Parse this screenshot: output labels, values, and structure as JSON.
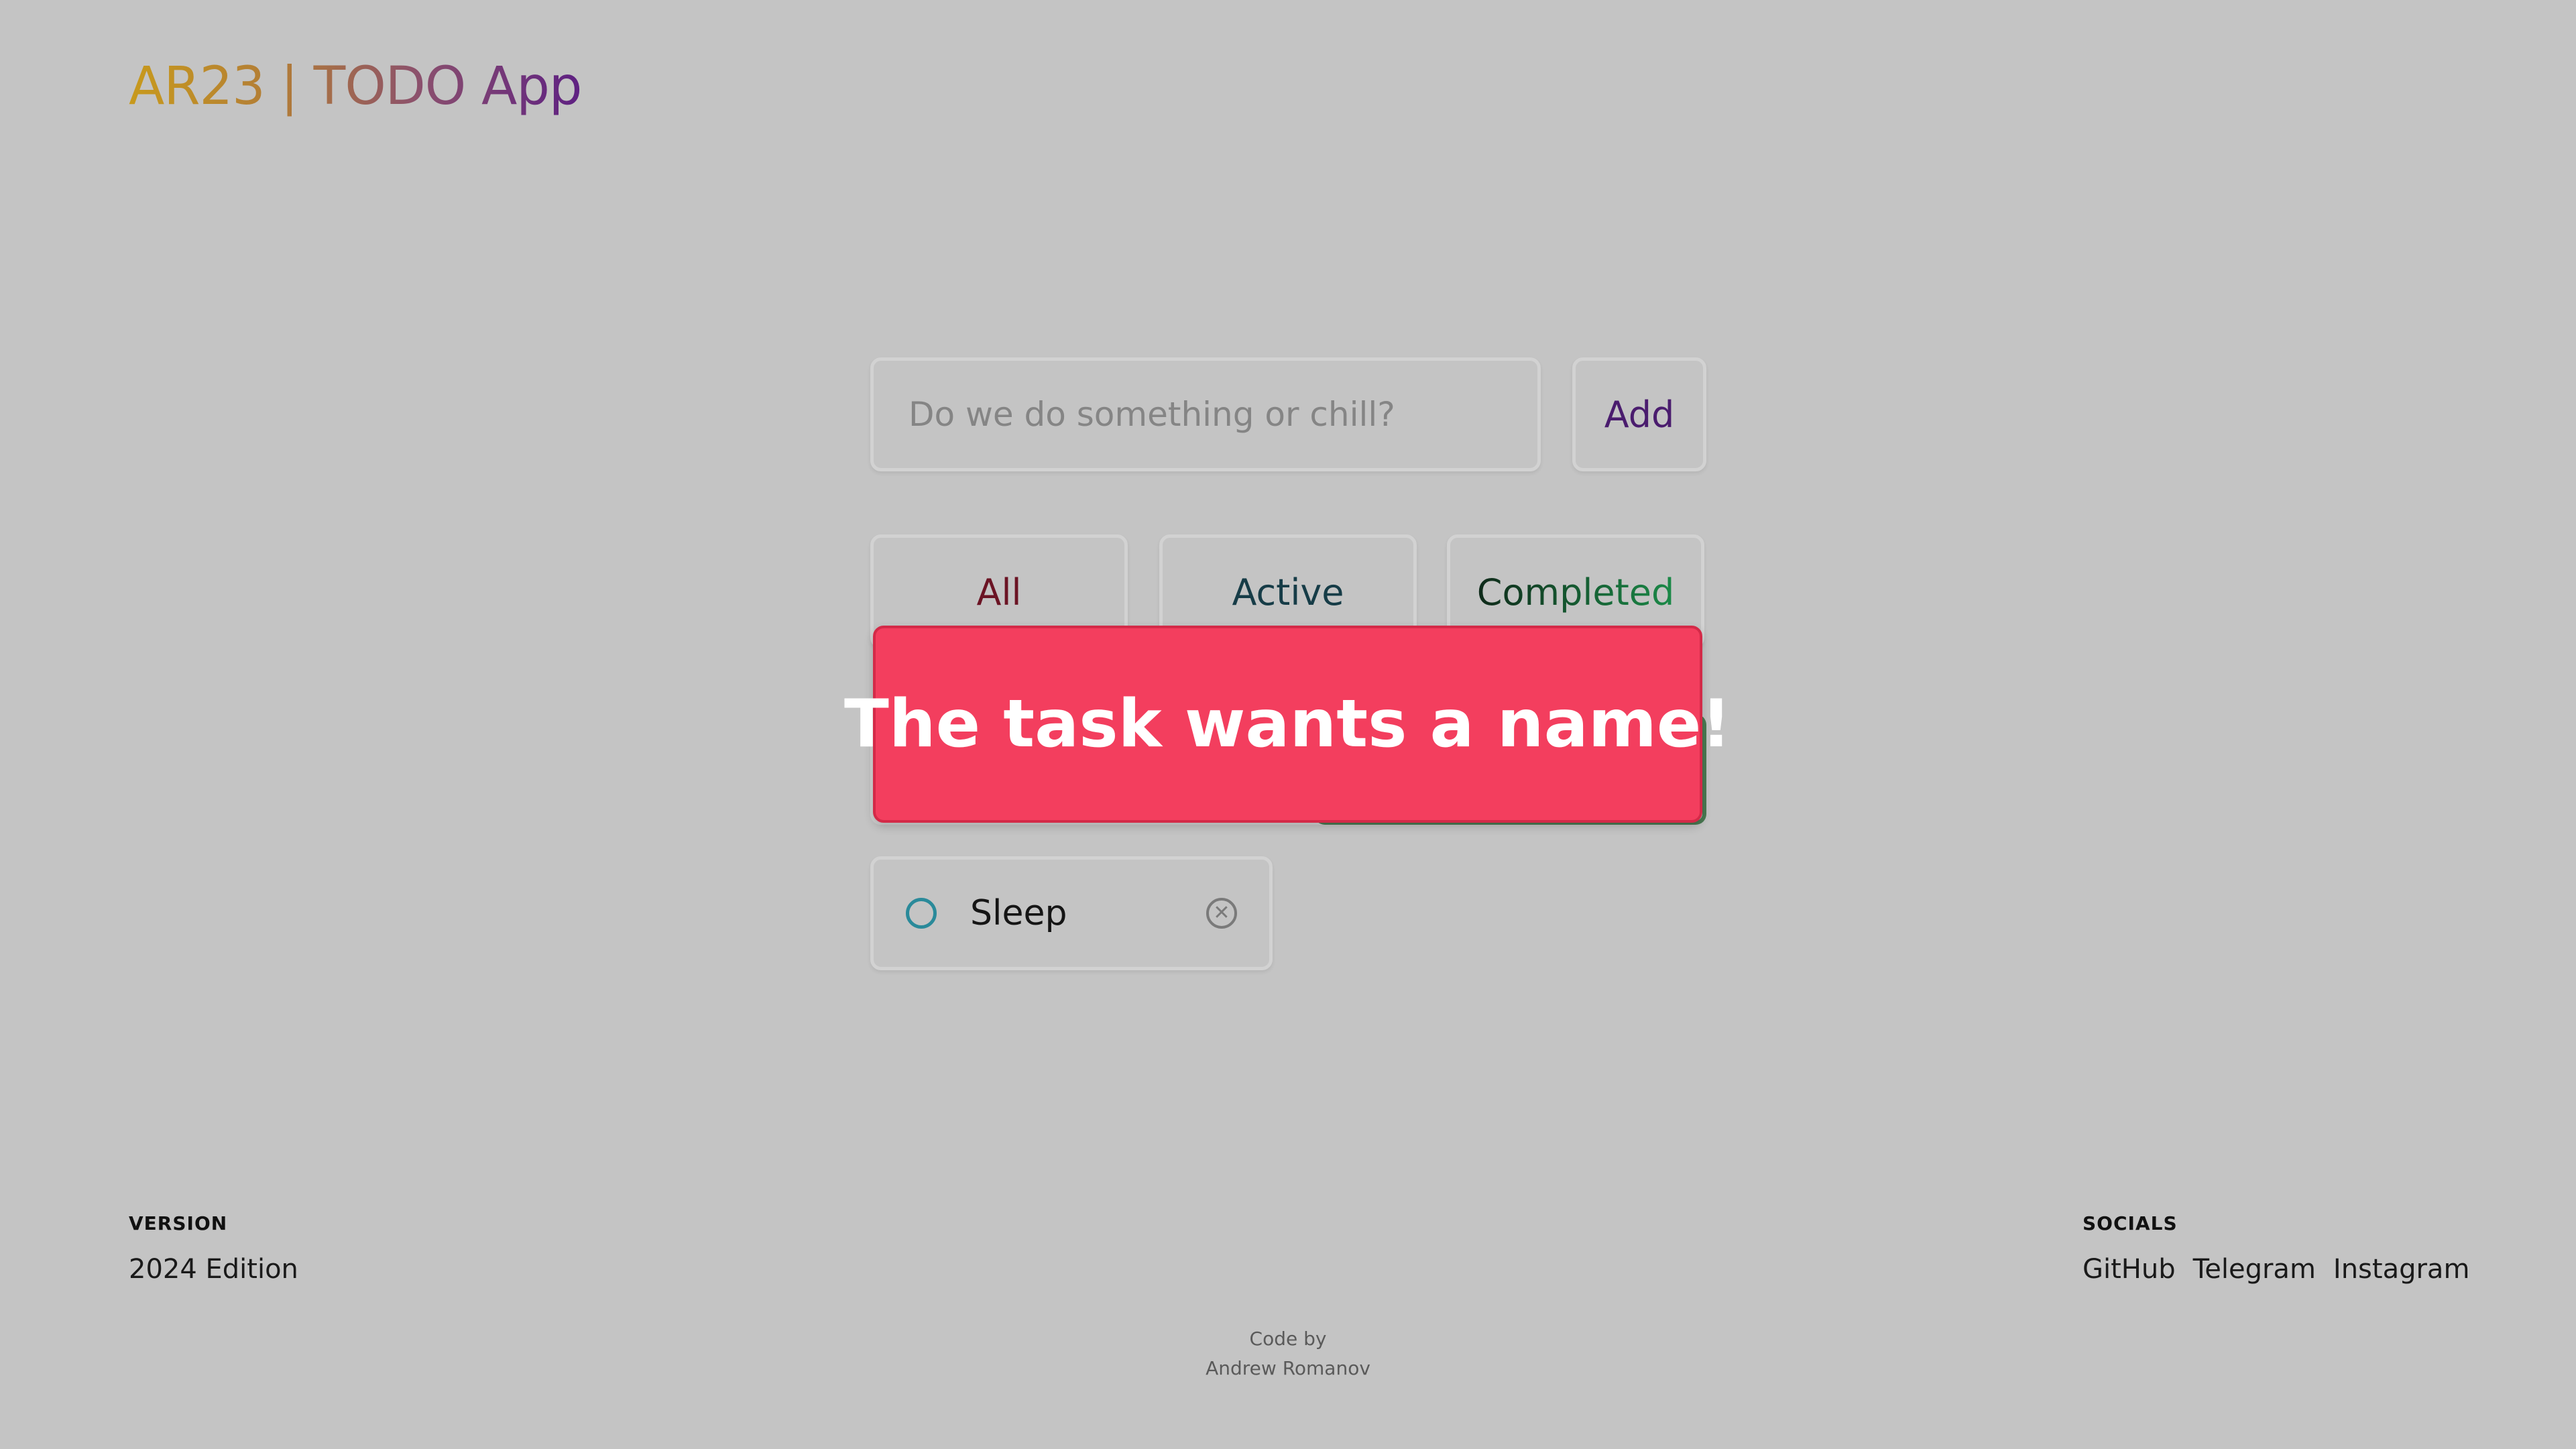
{
  "header": {
    "logo": "AR23 | TODO App"
  },
  "form": {
    "placeholder": "Do we do something or chill?",
    "add_label": "Add"
  },
  "filters": [
    {
      "label": "All"
    },
    {
      "label": "Active"
    },
    {
      "label": "Completed"
    }
  ],
  "toast": {
    "message": "The task wants a name!",
    "color": "#f33e5e"
  },
  "todos": [
    {
      "text": "Sleep",
      "completed": false
    }
  ],
  "footer": {
    "version_label": "VERSION",
    "version_value": "2024 Edition",
    "socials_label": "SOCIALS",
    "socials": [
      "GitHub",
      "Telegram",
      "Instagram"
    ],
    "credit_line1": "Code by",
    "credit_line2": "Andrew Romanov"
  },
  "colors": {
    "background": "#c4c4c4",
    "toast": "#f33e5e",
    "check": "#2a8a9a"
  }
}
